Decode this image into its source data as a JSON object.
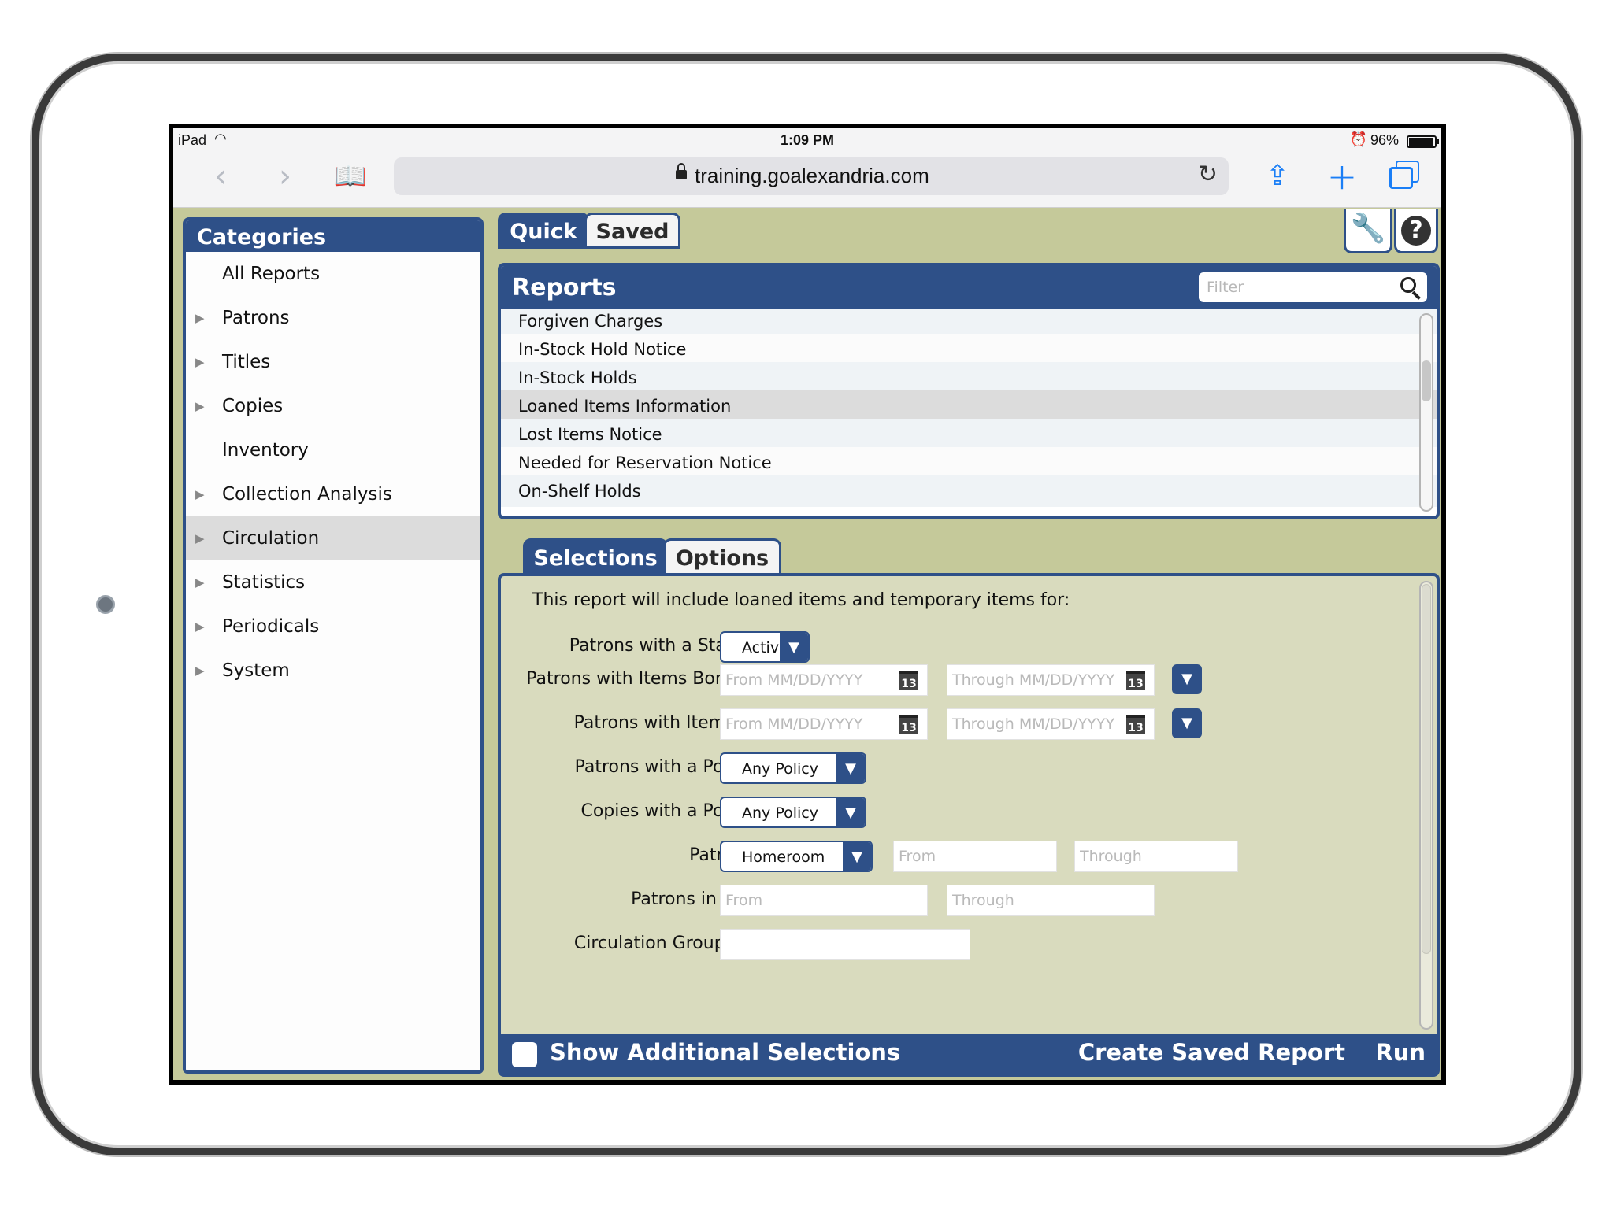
{
  "status_bar": {
    "device": "iPad",
    "time": "1:09 PM",
    "battery": "96%"
  },
  "safari": {
    "url": "training.goalexandria.com"
  },
  "top_tabs": {
    "quick": "Quick",
    "saved": "Saved"
  },
  "categories": {
    "title": "Categories",
    "items": [
      {
        "label": "All Reports",
        "has_arrow": false
      },
      {
        "label": "Patrons",
        "has_arrow": true
      },
      {
        "label": "Titles",
        "has_arrow": true
      },
      {
        "label": "Copies",
        "has_arrow": true
      },
      {
        "label": "Inventory",
        "has_arrow": false
      },
      {
        "label": "Collection Analysis",
        "has_arrow": true
      },
      {
        "label": "Circulation",
        "has_arrow": true,
        "selected": true
      },
      {
        "label": "Statistics",
        "has_arrow": true
      },
      {
        "label": "Periodicals",
        "has_arrow": true
      },
      {
        "label": "System",
        "has_arrow": true
      }
    ]
  },
  "reports": {
    "title": "Reports",
    "filter_placeholder": "Filter",
    "items": [
      "Forgiven Charges",
      "In-Stock Hold Notice",
      "In-Stock Holds",
      "Loaned Items Information",
      "Lost Items Notice",
      "Needed for Reservation Notice",
      "On-Shelf Holds"
    ],
    "selected_index": 3
  },
  "sub_tabs": {
    "selections": "Selections",
    "options": "Options"
  },
  "selections": {
    "intro": "This report will include loaned items and temporary items for:",
    "status_label": "Patrons with a Status of",
    "status_value": "Active",
    "borrowed_label": "Patrons with Items Borrowed",
    "due_label": "Patrons with Items Due",
    "from_date_placeholder": "From MM/DD/YYYY",
    "through_date_placeholder": "Through MM/DD/YYYY",
    "calendar_glyph": "13",
    "patron_policy_label": "Patrons with a Policy of",
    "patron_policy_value": "Any Policy",
    "copy_policy_label": "Copies with a Policy of",
    "copy_policy_value": "Any Policy",
    "patrons_in_label": "Patrons in",
    "patrons_in_value": "Homeroom",
    "from_placeholder": "From",
    "through_placeholder": "Through",
    "grade_label": "Patrons in Grade",
    "group_code_label": "Circulation Group Code"
  },
  "bottom_bar": {
    "show_additional": "Show Additional Selections",
    "create_saved": "Create Saved Report",
    "run": "Run"
  },
  "colors": {
    "accent": "#2e5088",
    "background": "#c5c99a",
    "panel": "#d9dbbe"
  }
}
